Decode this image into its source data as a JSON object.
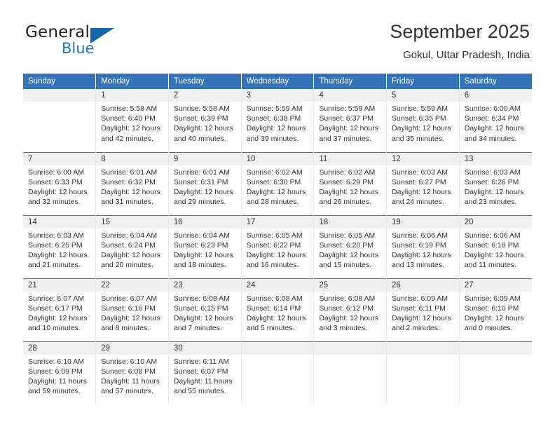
{
  "brand": {
    "name_dark": "General",
    "name_blue": "Blue",
    "accent_color": "#1565ab"
  },
  "header": {
    "title": "September 2025",
    "subtitle": "Gokul, Uttar Pradesh, India",
    "header_bg": "#3573b9"
  },
  "weekdays": [
    "Sunday",
    "Monday",
    "Tuesday",
    "Wednesday",
    "Thursday",
    "Friday",
    "Saturday"
  ],
  "weeks": [
    [
      {
        "day": "",
        "sunrise": "",
        "sunset": "",
        "daylight_1": "",
        "daylight_2": ""
      },
      {
        "day": "1",
        "sunrise": "Sunrise: 5:58 AM",
        "sunset": "Sunset: 6:40 PM",
        "daylight_1": "Daylight: 12 hours",
        "daylight_2": "and 42 minutes."
      },
      {
        "day": "2",
        "sunrise": "Sunrise: 5:58 AM",
        "sunset": "Sunset: 6:39 PM",
        "daylight_1": "Daylight: 12 hours",
        "daylight_2": "and 40 minutes."
      },
      {
        "day": "3",
        "sunrise": "Sunrise: 5:59 AM",
        "sunset": "Sunset: 6:38 PM",
        "daylight_1": "Daylight: 12 hours",
        "daylight_2": "and 39 minutes."
      },
      {
        "day": "4",
        "sunrise": "Sunrise: 5:59 AM",
        "sunset": "Sunset: 6:37 PM",
        "daylight_1": "Daylight: 12 hours",
        "daylight_2": "and 37 minutes."
      },
      {
        "day": "5",
        "sunrise": "Sunrise: 5:59 AM",
        "sunset": "Sunset: 6:35 PM",
        "daylight_1": "Daylight: 12 hours",
        "daylight_2": "and 35 minutes."
      },
      {
        "day": "6",
        "sunrise": "Sunrise: 6:00 AM",
        "sunset": "Sunset: 6:34 PM",
        "daylight_1": "Daylight: 12 hours",
        "daylight_2": "and 34 minutes."
      }
    ],
    [
      {
        "day": "7",
        "sunrise": "Sunrise: 6:00 AM",
        "sunset": "Sunset: 6:33 PM",
        "daylight_1": "Daylight: 12 hours",
        "daylight_2": "and 32 minutes."
      },
      {
        "day": "8",
        "sunrise": "Sunrise: 6:01 AM",
        "sunset": "Sunset: 6:32 PM",
        "daylight_1": "Daylight: 12 hours",
        "daylight_2": "and 31 minutes."
      },
      {
        "day": "9",
        "sunrise": "Sunrise: 6:01 AM",
        "sunset": "Sunset: 6:31 PM",
        "daylight_1": "Daylight: 12 hours",
        "daylight_2": "and 29 minutes."
      },
      {
        "day": "10",
        "sunrise": "Sunrise: 6:02 AM",
        "sunset": "Sunset: 6:30 PM",
        "daylight_1": "Daylight: 12 hours",
        "daylight_2": "and 28 minutes."
      },
      {
        "day": "11",
        "sunrise": "Sunrise: 6:02 AM",
        "sunset": "Sunset: 6:29 PM",
        "daylight_1": "Daylight: 12 hours",
        "daylight_2": "and 26 minutes."
      },
      {
        "day": "12",
        "sunrise": "Sunrise: 6:03 AM",
        "sunset": "Sunset: 6:27 PM",
        "daylight_1": "Daylight: 12 hours",
        "daylight_2": "and 24 minutes."
      },
      {
        "day": "13",
        "sunrise": "Sunrise: 6:03 AM",
        "sunset": "Sunset: 6:26 PM",
        "daylight_1": "Daylight: 12 hours",
        "daylight_2": "and 23 minutes."
      }
    ],
    [
      {
        "day": "14",
        "sunrise": "Sunrise: 6:03 AM",
        "sunset": "Sunset: 6:25 PM",
        "daylight_1": "Daylight: 12 hours",
        "daylight_2": "and 21 minutes."
      },
      {
        "day": "15",
        "sunrise": "Sunrise: 6:04 AM",
        "sunset": "Sunset: 6:24 PM",
        "daylight_1": "Daylight: 12 hours",
        "daylight_2": "and 20 minutes."
      },
      {
        "day": "16",
        "sunrise": "Sunrise: 6:04 AM",
        "sunset": "Sunset: 6:23 PM",
        "daylight_1": "Daylight: 12 hours",
        "daylight_2": "and 18 minutes."
      },
      {
        "day": "17",
        "sunrise": "Sunrise: 6:05 AM",
        "sunset": "Sunset: 6:22 PM",
        "daylight_1": "Daylight: 12 hours",
        "daylight_2": "and 16 minutes."
      },
      {
        "day": "18",
        "sunrise": "Sunrise: 6:05 AM",
        "sunset": "Sunset: 6:20 PM",
        "daylight_1": "Daylight: 12 hours",
        "daylight_2": "and 15 minutes."
      },
      {
        "day": "19",
        "sunrise": "Sunrise: 6:06 AM",
        "sunset": "Sunset: 6:19 PM",
        "daylight_1": "Daylight: 12 hours",
        "daylight_2": "and 13 minutes."
      },
      {
        "day": "20",
        "sunrise": "Sunrise: 6:06 AM",
        "sunset": "Sunset: 6:18 PM",
        "daylight_1": "Daylight: 12 hours",
        "daylight_2": "and 11 minutes."
      }
    ],
    [
      {
        "day": "21",
        "sunrise": "Sunrise: 6:07 AM",
        "sunset": "Sunset: 6:17 PM",
        "daylight_1": "Daylight: 12 hours",
        "daylight_2": "and 10 minutes."
      },
      {
        "day": "22",
        "sunrise": "Sunrise: 6:07 AM",
        "sunset": "Sunset: 6:16 PM",
        "daylight_1": "Daylight: 12 hours",
        "daylight_2": "and 8 minutes."
      },
      {
        "day": "23",
        "sunrise": "Sunrise: 6:08 AM",
        "sunset": "Sunset: 6:15 PM",
        "daylight_1": "Daylight: 12 hours",
        "daylight_2": "and 7 minutes."
      },
      {
        "day": "24",
        "sunrise": "Sunrise: 6:08 AM",
        "sunset": "Sunset: 6:14 PM",
        "daylight_1": "Daylight: 12 hours",
        "daylight_2": "and 5 minutes."
      },
      {
        "day": "25",
        "sunrise": "Sunrise: 6:08 AM",
        "sunset": "Sunset: 6:12 PM",
        "daylight_1": "Daylight: 12 hours",
        "daylight_2": "and 3 minutes."
      },
      {
        "day": "26",
        "sunrise": "Sunrise: 6:09 AM",
        "sunset": "Sunset: 6:11 PM",
        "daylight_1": "Daylight: 12 hours",
        "daylight_2": "and 2 minutes."
      },
      {
        "day": "27",
        "sunrise": "Sunrise: 6:09 AM",
        "sunset": "Sunset: 6:10 PM",
        "daylight_1": "Daylight: 12 hours",
        "daylight_2": "and 0 minutes."
      }
    ],
    [
      {
        "day": "28",
        "sunrise": "Sunrise: 6:10 AM",
        "sunset": "Sunset: 6:09 PM",
        "daylight_1": "Daylight: 11 hours",
        "daylight_2": "and 59 minutes."
      },
      {
        "day": "29",
        "sunrise": "Sunrise: 6:10 AM",
        "sunset": "Sunset: 6:08 PM",
        "daylight_1": "Daylight: 11 hours",
        "daylight_2": "and 57 minutes."
      },
      {
        "day": "30",
        "sunrise": "Sunrise: 6:11 AM",
        "sunset": "Sunset: 6:07 PM",
        "daylight_1": "Daylight: 11 hours",
        "daylight_2": "and 55 minutes."
      },
      {
        "day": "",
        "sunrise": "",
        "sunset": "",
        "daylight_1": "",
        "daylight_2": ""
      },
      {
        "day": "",
        "sunrise": "",
        "sunset": "",
        "daylight_1": "",
        "daylight_2": ""
      },
      {
        "day": "",
        "sunrise": "",
        "sunset": "",
        "daylight_1": "",
        "daylight_2": ""
      },
      {
        "day": "",
        "sunrise": "",
        "sunset": "",
        "daylight_1": "",
        "daylight_2": ""
      }
    ]
  ]
}
